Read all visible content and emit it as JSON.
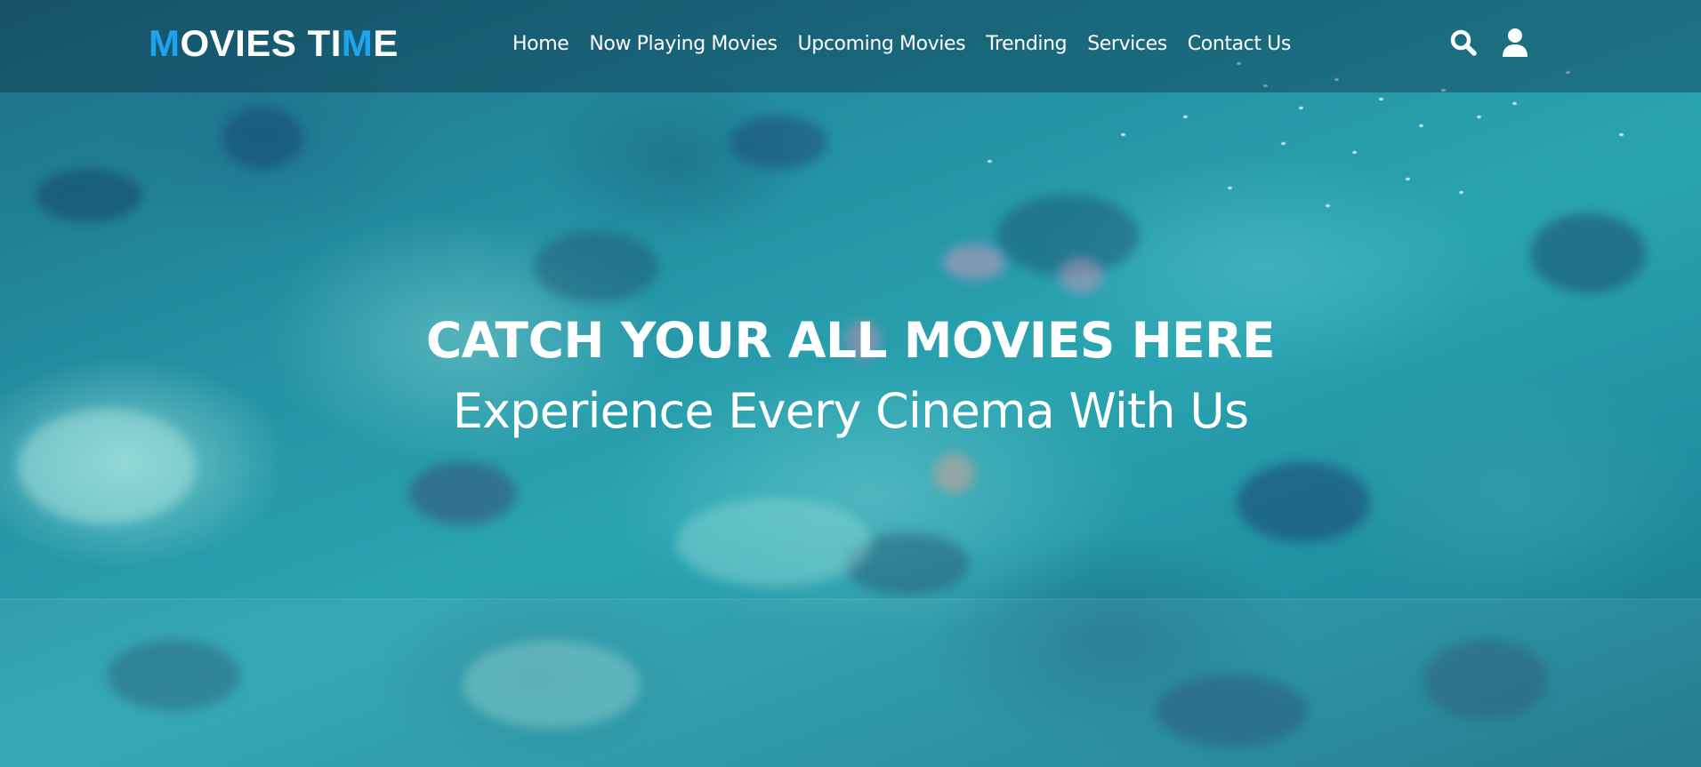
{
  "brand": {
    "logo_first": "M",
    "logo_middle": "OVIES TI",
    "logo_accent": "M",
    "logo_last": "E",
    "accent_color": "#1ea3ec"
  },
  "nav": {
    "links": [
      {
        "label": "Home"
      },
      {
        "label": "Now Playing Movies"
      },
      {
        "label": "Upcoming Movies"
      },
      {
        "label": "Trending"
      },
      {
        "label": "Services"
      },
      {
        "label": "Contact Us"
      }
    ],
    "icons": [
      "search-icon",
      "user-icon"
    ]
  },
  "hero": {
    "title": "CATCH YOUR ALL MOVIES HERE",
    "subtitle": "Experience Every Cinema With Us",
    "text_color": "#ffffff"
  }
}
